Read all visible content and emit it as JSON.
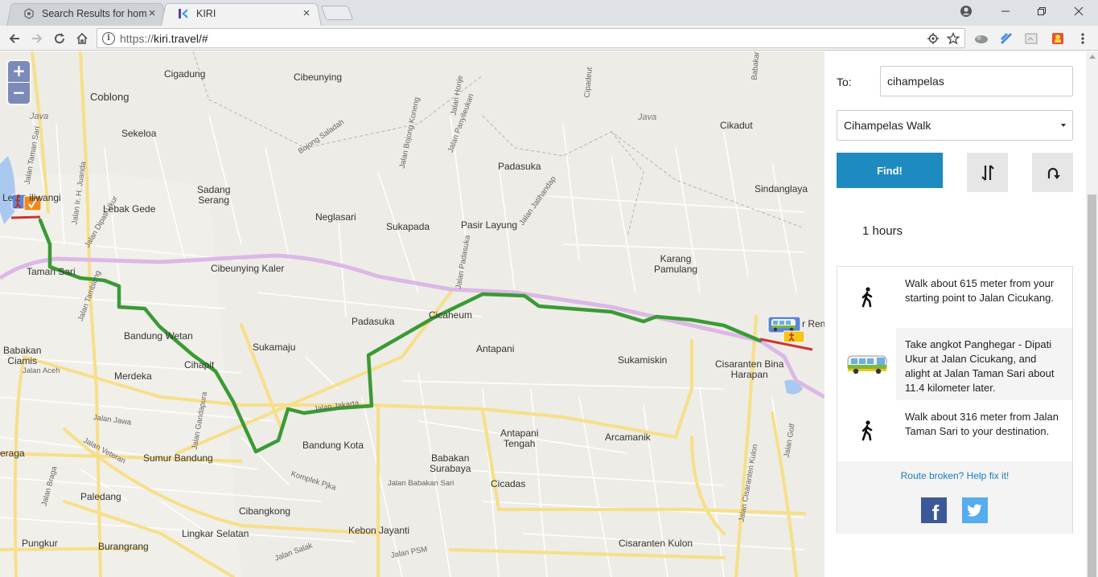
{
  "browser": {
    "tabs": [
      {
        "title": "Search Results for home",
        "active": false,
        "icon": "gear-favicon"
      },
      {
        "title": "KIRI",
        "active": true,
        "icon": "kiri-favicon"
      }
    ],
    "url_scheme": "https://",
    "url_rest": "kiri.travel/#"
  },
  "map": {
    "zoom_in": "+",
    "zoom_out": "−",
    "places": [
      {
        "id": "cigadung",
        "text": "Cigadung"
      },
      {
        "id": "coblong",
        "text": "Coblong"
      },
      {
        "id": "cibeunying",
        "text": "Cibeunying"
      },
      {
        "id": "java1",
        "text": "Java"
      },
      {
        "id": "java2",
        "text": "Java"
      },
      {
        "id": "sekeloa",
        "text": "Sekeloa"
      },
      {
        "id": "cikadut",
        "text": "Cikadut"
      },
      {
        "id": "padasuka1",
        "text": "Padasuka"
      },
      {
        "id": "sadangserang",
        "text": "Sadang\nSerang"
      },
      {
        "id": "sindanglaya",
        "text": "Sindanglaya"
      },
      {
        "id": "lebakgede",
        "text": "Lebak Gede"
      },
      {
        "id": "neglasari",
        "text": "Neglasari"
      },
      {
        "id": "sukapada",
        "text": "Sukapada"
      },
      {
        "id": "pasirlayung",
        "text": "Pasir Layung"
      },
      {
        "id": "lebaksiliwangi",
        "text": "Le      iliwangi"
      },
      {
        "id": "tamansari",
        "text": "Taman Sari"
      },
      {
        "id": "cibeunyingkaler",
        "text": "Cibeunying Kaler"
      },
      {
        "id": "karangpamulang",
        "text": "Karang\nPamulang"
      },
      {
        "id": "cicaheum",
        "text": "Cicaheum"
      },
      {
        "id": "padasuka2",
        "text": "Padasuka"
      },
      {
        "id": "bandungwetan",
        "text": "Bandung Wetan"
      },
      {
        "id": "babakanciamis",
        "text": "Babakan\nCiamis"
      },
      {
        "id": "sukamaju",
        "text": "Sukamaju"
      },
      {
        "id": "antapani",
        "text": "Antapani"
      },
      {
        "id": "sukamiskin",
        "text": "Sukamiskin"
      },
      {
        "id": "cisaranten",
        "text": "Cisaranten Bina\nHarapan"
      },
      {
        "id": "merdeka",
        "text": "Merdeka"
      },
      {
        "id": "cihapit",
        "text": "Cihapit"
      },
      {
        "id": "antapanitengah",
        "text": "Antapani\nTengah"
      },
      {
        "id": "arcamanik",
        "text": "Arcamanik"
      },
      {
        "id": "bandungkota",
        "text": "Bandung Kota"
      },
      {
        "id": "babakansurabaya",
        "text": "Babakan\nSurabaya"
      },
      {
        "id": "eraga",
        "text": "eraga"
      },
      {
        "id": "sumurbandung",
        "text": "Sumur Bandung"
      },
      {
        "id": "cicadas",
        "text": "Cicadas"
      },
      {
        "id": "paledang",
        "text": "Paledang"
      },
      {
        "id": "cibangkong",
        "text": "Cibangkong"
      },
      {
        "id": "lingkarselatan",
        "text": "Lingkar Selatan"
      },
      {
        "id": "kebonjayanti",
        "text": "Kebon Jayanti"
      },
      {
        "id": "pungkur",
        "text": "Pungkur"
      },
      {
        "id": "burangrang",
        "text": "Burangrang"
      },
      {
        "id": "cisarantenkulon",
        "text": "Cisaranten Kulon"
      },
      {
        "id": "rene",
        "text": "r Rene"
      }
    ],
    "roads": [
      {
        "id": "r1",
        "text": "Jalan Ir. H. Juanda"
      },
      {
        "id": "r2",
        "text": "Jalan Dipati Ukur"
      },
      {
        "id": "r3",
        "text": "Jalan Padasuka"
      },
      {
        "id": "r4",
        "text": "Jalan Jatihandap"
      },
      {
        "id": "r5",
        "text": "Jalan Bojong Koneng"
      },
      {
        "id": "r6",
        "text": "Jalan Panyileukan"
      },
      {
        "id": "r7",
        "text": "Bojong Saladah"
      },
      {
        "id": "r8",
        "text": "Jalan Gandapura"
      },
      {
        "id": "r9",
        "text": "Jalan Jawa"
      },
      {
        "id": "r10",
        "text": "Jalan Braga"
      },
      {
        "id": "r11",
        "text": "Jalan Veteran"
      },
      {
        "id": "r12",
        "text": "Jalan Aceh"
      },
      {
        "id": "r13",
        "text": "Jalan Jakarta"
      },
      {
        "id": "r14",
        "text": "Komplek Pjka"
      },
      {
        "id": "r15",
        "text": "Jalan Babakan Sari"
      },
      {
        "id": "r16",
        "text": "Jalan Salak"
      },
      {
        "id": "r17",
        "text": "Jalan PSM"
      },
      {
        "id": "r18",
        "text": "Jalan Cisaranten Kulon"
      },
      {
        "id": "r19",
        "text": "Jalan Golf"
      },
      {
        "id": "r20",
        "text": "Jalan Taman Sari"
      },
      {
        "id": "r21",
        "text": "Jalan Tamblong"
      },
      {
        "id": "r22",
        "text": "Cipadeut"
      },
      {
        "id": "r23",
        "text": "Babakan"
      },
      {
        "id": "r24",
        "text": "Jalan Honje"
      }
    ]
  },
  "sidebar": {
    "to_label": "To:",
    "to_value": "cihampelas",
    "destination_select": "Cihampelas Walk",
    "find_label": "Find!",
    "duration": "1 hours",
    "steps": [
      {
        "icon": "walk-icon",
        "text": "Walk about 615 meter from your starting point to Jalan Cicukang."
      },
      {
        "icon": "angkot-icon",
        "text": "Take angkot Panghegar - Dipati Ukur at Jalan Cicukang, and alight at Jalan Taman Sari about 11.4 kilometer later."
      },
      {
        "icon": "walk-icon",
        "text": "Walk about 316 meter from Jalan Taman Sari to your destination."
      }
    ],
    "fix_link": "Route broken? Help fix it!",
    "facebook": "f"
  },
  "colors": {
    "route": "#3a9a35",
    "accent": "#1d8bbf",
    "major_road": "#f7df8a",
    "toll_road": "#dcb8e6"
  }
}
